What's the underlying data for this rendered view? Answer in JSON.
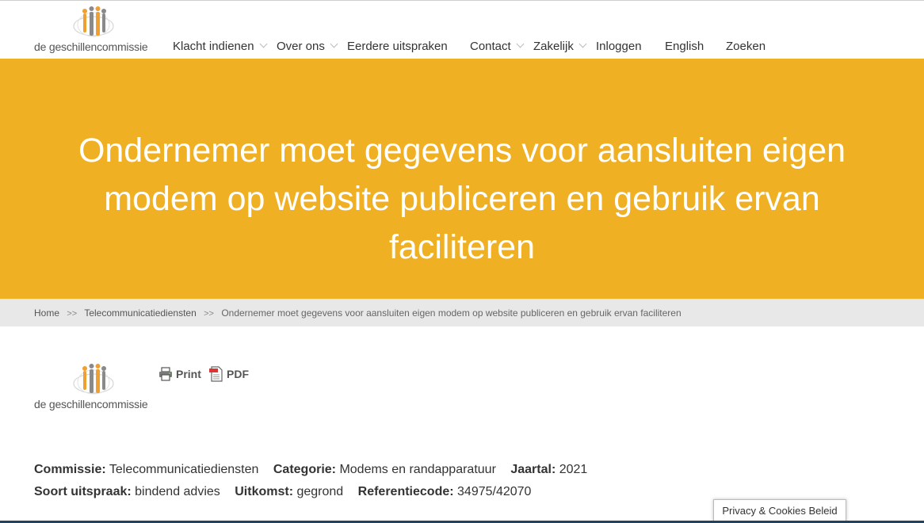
{
  "header": {
    "logo_text": "de geschillencommissie",
    "nav": [
      {
        "label": "Klacht indienen",
        "dropdown": true
      },
      {
        "label": "Over ons",
        "dropdown": true
      },
      {
        "label": "Eerdere uitspraken",
        "dropdown": false
      },
      {
        "label": "Contact",
        "dropdown": true
      },
      {
        "label": "Zakelijk",
        "dropdown": true
      },
      {
        "label": "Inloggen",
        "dropdown": false
      },
      {
        "label": "English",
        "dropdown": false
      },
      {
        "label": "Zoeken",
        "dropdown": false
      }
    ]
  },
  "hero": {
    "title": "Ondernemer moet gegevens voor aansluiten eigen modem op website publiceren en gebruik ervan faciliteren",
    "background": "#f0b024"
  },
  "breadcrumb": {
    "items": [
      "Home",
      "Telecommunicatiediensten",
      "Ondernemer moet gegevens voor aansluiten eigen modem op website publiceren en gebruik ervan faciliteren"
    ],
    "separator": ">>"
  },
  "doc": {
    "logo_text": "de geschillencommissie",
    "print_label": "Print",
    "pdf_label": "PDF"
  },
  "meta": {
    "row1": [
      {
        "key": "Commissie:",
        "value": "Telecommunicatiediensten"
      },
      {
        "key": "Categorie:",
        "value": "Modems en randapparatuur"
      },
      {
        "key": "Jaartal:",
        "value": "2021"
      }
    ],
    "row2": [
      {
        "key": "Soort uitspraak:",
        "value": "bindend advies"
      },
      {
        "key": "Uitkomst:",
        "value": "gegrond"
      },
      {
        "key": "Referentiecode:",
        "value": "34975/42070"
      }
    ]
  },
  "privacy": {
    "label": "Privacy & Cookies Beleid"
  }
}
